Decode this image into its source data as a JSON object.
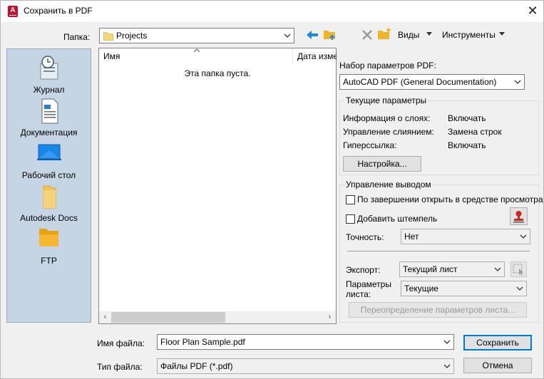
{
  "window": {
    "title": "Сохранить в PDF",
    "close_glyph": "✕"
  },
  "toolbar": {
    "folder_label": "Папка:",
    "folder_value": "Projects",
    "views_label": "Виды",
    "tools_label": "Инструменты"
  },
  "places": [
    {
      "label": "Журнал",
      "icon": "history-icon"
    },
    {
      "label": "Документация",
      "icon": "documents-icon"
    },
    {
      "label": "Рабочий стол",
      "icon": "desktop-icon"
    },
    {
      "label": "Autodesk Docs",
      "icon": "autodesk-docs-icon"
    },
    {
      "label": "FTP",
      "icon": "ftp-icon"
    }
  ],
  "file_list": {
    "columns": [
      "Имя",
      "Дата изме"
    ],
    "empty_message": "Эта папка пуста."
  },
  "pdf": {
    "preset_label": "Набор параметров PDF:",
    "preset_value": "AutoCAD PDF (General Documentation)",
    "current": {
      "title": "Текущие параметры",
      "rows": [
        {
          "key": "Информация о слоях:",
          "value": "Включать"
        },
        {
          "key": "Управление слиянием:",
          "value": "Замена строк"
        },
        {
          "key": "Гиперссылка:",
          "value": "Включать"
        }
      ],
      "setup_button": "Настройка..."
    },
    "output": {
      "title": "Управление выводом",
      "open_viewer": "По завершении открыть в средстве просмотра",
      "add_stamp": "Добавить штемпель",
      "precision_label": "Точность:",
      "precision_value": "Нет",
      "export_label": "Экспорт:",
      "export_value": "Текущий лист",
      "sheet_params_label_1": "Параметры",
      "sheet_params_label_2": "листа:",
      "sheet_params_value": "Текущие",
      "override_button": "Переопределение параметров листа..."
    }
  },
  "bottom": {
    "filename_label": "Имя файла:",
    "filename_value": "Floor Plan Sample.pdf",
    "filetype_label": "Тип файла:",
    "filetype_value": "Файлы PDF (*.pdf)",
    "save_button": "Сохранить",
    "cancel_button": "Отмена"
  },
  "colors": {
    "accent": "#0078d7",
    "places_bg": "#c5d5e4",
    "autodesk_red": "#c8102e"
  }
}
